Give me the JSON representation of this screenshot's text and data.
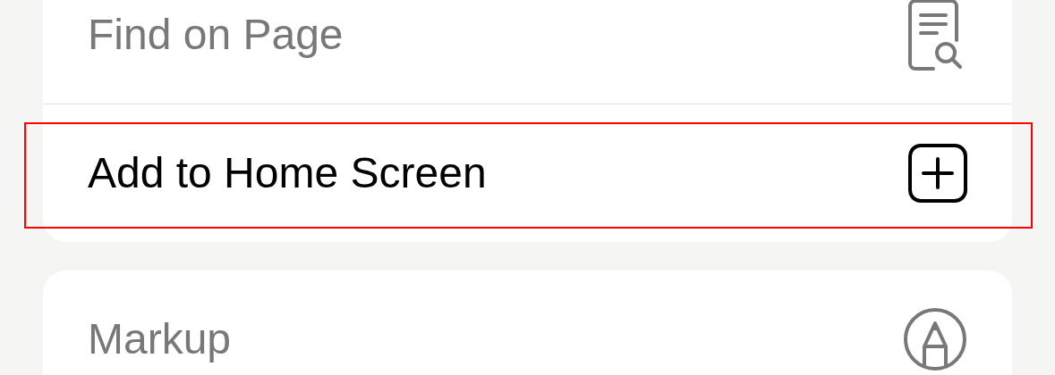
{
  "groups": [
    {
      "items": [
        {
          "label": "Find on Page",
          "kind": "find",
          "dimmed": true,
          "highlighted": false
        },
        {
          "label": "Add to Home Screen",
          "kind": "add",
          "dimmed": false,
          "highlighted": true
        }
      ]
    },
    {
      "items": [
        {
          "label": "Markup",
          "kind": "markup",
          "dimmed": true,
          "highlighted": false
        }
      ]
    }
  ]
}
